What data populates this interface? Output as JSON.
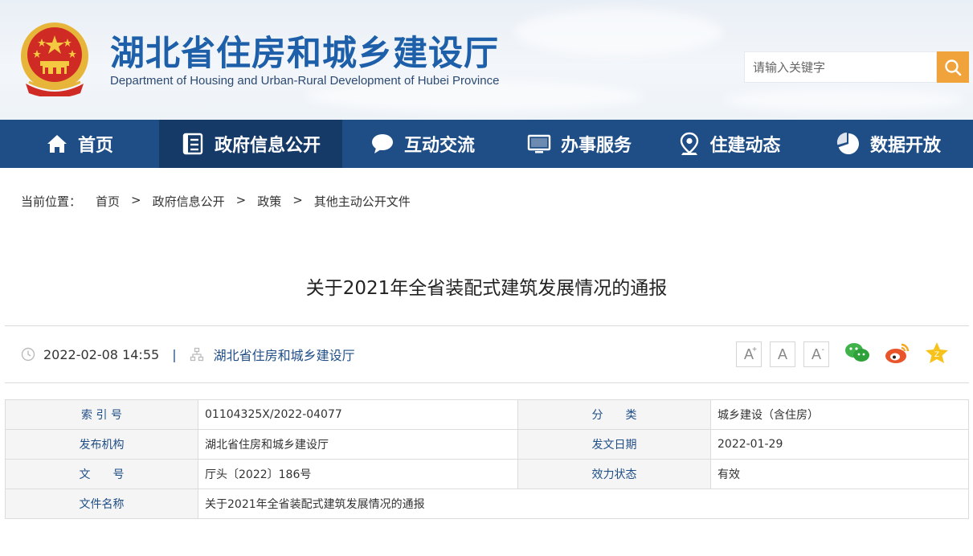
{
  "header": {
    "title": "湖北省住房和城乡建设厅",
    "subtitle": "Department of Housing and Urban-Rural Development of Hubei Province",
    "search_placeholder": "请输入关键字"
  },
  "nav": [
    {
      "label": "首页",
      "icon": "home-icon"
    },
    {
      "label": "政府信息公开",
      "icon": "document-list-icon",
      "active": true
    },
    {
      "label": "互动交流",
      "icon": "chat-bubble-icon"
    },
    {
      "label": "办事服务",
      "icon": "monitor-icon"
    },
    {
      "label": "住建动态",
      "icon": "location-pin-icon"
    },
    {
      "label": "数据开放",
      "icon": "pie-chart-icon"
    }
  ],
  "breadcrumb": {
    "prefix": "当前位置：",
    "items": [
      "首页",
      "政府信息公开",
      "政策",
      "其他主动公开文件"
    ],
    "separator": ">"
  },
  "article": {
    "title": "关于2021年全省装配式建筑发展情况的通报",
    "datetime": "2022-02-08 14:55",
    "meta_separator": "|",
    "org": "湖北省住房和城乡建设厅",
    "font_sizes": [
      "A+",
      "A",
      "A-"
    ]
  },
  "info_table": {
    "rows": [
      {
        "label1": "索 引 号",
        "value1": "01104325X/2022-04077",
        "label2": "分　　类",
        "value2": "城乡建设（含住房）"
      },
      {
        "label1": "发布机构",
        "value1": "湖北省住房和城乡建设厅",
        "label2": "发文日期",
        "value2": "2022-01-29"
      },
      {
        "label1": "文　　号",
        "value1": "厅头〔2022〕186号",
        "label2": "效力状态",
        "value2": "有效"
      },
      {
        "label1": "文件名称",
        "value1": "关于2021年全省装配式建筑发展情况的通报"
      }
    ]
  },
  "colors": {
    "nav_bg": "#1f4e87",
    "nav_active": "#153a68",
    "brand_blue": "#1d5fa8",
    "search_button": "#f0a33a"
  }
}
